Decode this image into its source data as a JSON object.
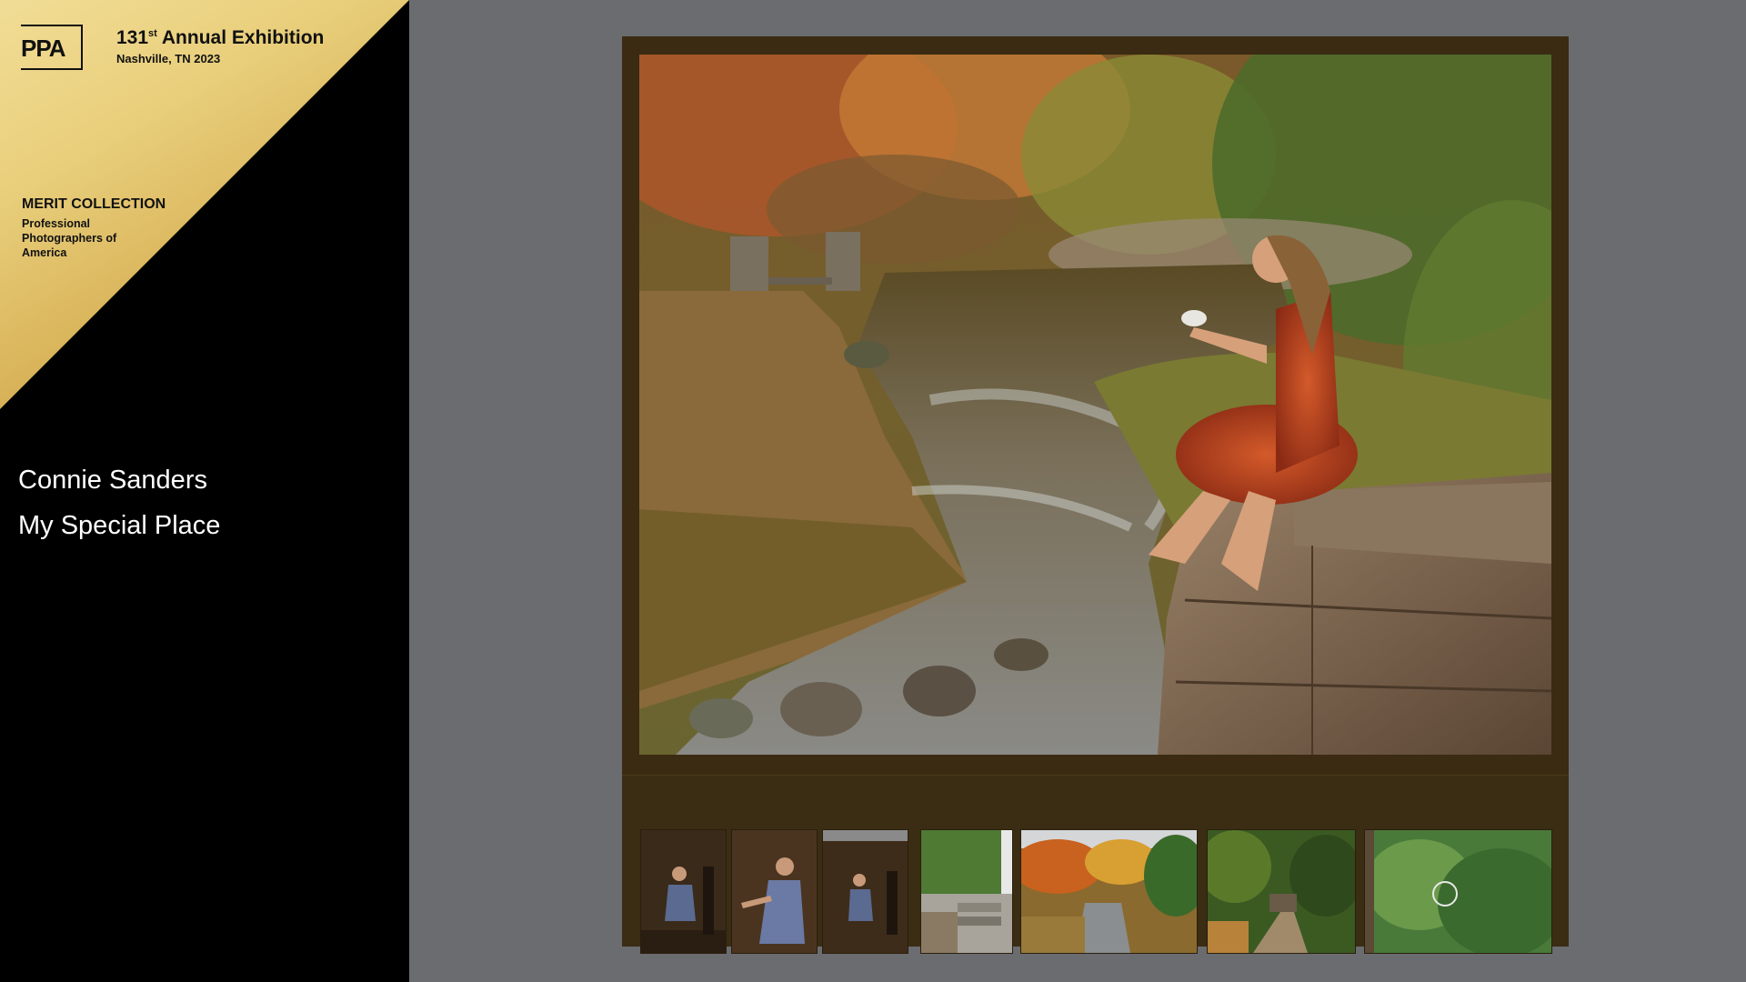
{
  "header": {
    "logo_text": "PPA",
    "exhibition_number": "131",
    "exhibition_suffix": "st",
    "exhibition_title": " Annual Exhibition",
    "exhibition_location": "Nashville, TN 2023",
    "collection_title": "MERIT COLLECTION",
    "organization": "Professional Photographers of America"
  },
  "artwork": {
    "artist": "Connie Sanders",
    "title": "My Special Place"
  },
  "colors": {
    "gold_light": "#f1dd96",
    "gold_dark": "#c59233",
    "frame": "#3a2b12",
    "background": "#6b6c70"
  },
  "thumbnails": [
    {
      "name": "studio-pose-1"
    },
    {
      "name": "studio-pose-2"
    },
    {
      "name": "studio-pose-3"
    },
    {
      "name": "stone-steps"
    },
    {
      "name": "autumn-stream"
    },
    {
      "name": "forest-bridge"
    },
    {
      "name": "green-foliage"
    }
  ]
}
